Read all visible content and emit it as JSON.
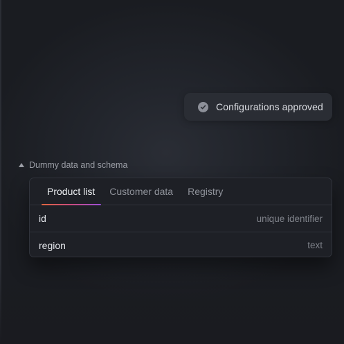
{
  "toast": {
    "icon": "check-circle-icon",
    "label": "Configurations approved"
  },
  "section": {
    "caret_icon": "caret-up-icon",
    "label": "Dummy data and schema",
    "expanded": true
  },
  "tabs": [
    {
      "label": "Product list",
      "active": true
    },
    {
      "label": "Customer data",
      "active": false
    },
    {
      "label": "Registry",
      "active": false
    }
  ],
  "rows": [
    {
      "name": "id",
      "type": "unique identifier"
    },
    {
      "name": "region",
      "type": "text"
    }
  ],
  "colors": {
    "background": "#1b1d23",
    "accent_gradient": [
      "#e1653f",
      "#c84b7e",
      "#9b4fd8"
    ],
    "text_primary": "#e3e5ea",
    "text_muted": "#8f929a"
  }
}
